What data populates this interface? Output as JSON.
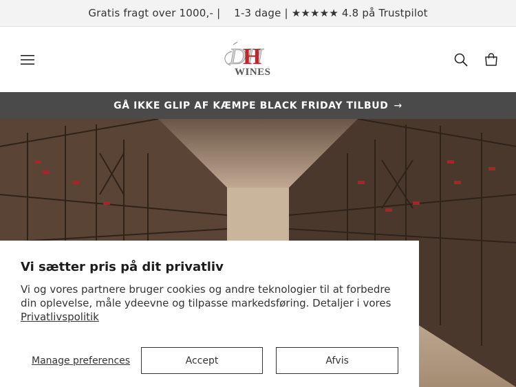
{
  "announcement": {
    "text": "Gratis fragt over 1000,- |    1-3 dage | ★★★★★ 4.8 på Trustpilot"
  },
  "header": {
    "logo_text_dh": "DH",
    "logo_text_wines": "WINES"
  },
  "promo": {
    "label": "GÅ IKKE GLIP AF KÆMPE BLACK FRIDAY TILBUD",
    "arrow": "→"
  },
  "hero": {
    "image": "wine-cellar"
  },
  "consent": {
    "title": "Vi sætter pris på dit privatliv",
    "body": "Vi og vores partnere bruger cookies og andre teknologier til at forbedre din oplevelse, måle ydeevne og tilpasse markedsføring. Detaljer i vores",
    "policy_link": "Privatlivspolitik",
    "manage_label": "Manage preferences",
    "accept_label": "Accept",
    "decline_label": "Afvis"
  },
  "colors": {
    "promo_bg": "#4a4a4a",
    "logo_red": "#c0272d",
    "topbar_bg": "#f3f3f3"
  },
  "icons": [
    "menu-icon",
    "search-icon",
    "cart-icon",
    "arrow-right-icon"
  ]
}
